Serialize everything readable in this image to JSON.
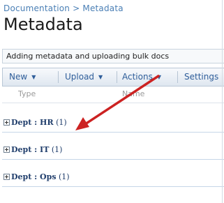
{
  "breadcrumb": "Documentation > Metadata",
  "page_title": "Metadata",
  "description": "Adding metadata and uploading bulk docs",
  "toolbar": {
    "new": "New",
    "upload": "Upload",
    "actions": "Actions",
    "settings": "Settings"
  },
  "columns": {
    "type": "Type",
    "name": "Name"
  },
  "groups": [
    {
      "field": "Dept",
      "value": "HR",
      "count": "(1)"
    },
    {
      "field": "Dept",
      "value": "IT",
      "count": "(1)"
    },
    {
      "field": "Dept",
      "value": "Ops",
      "count": "(1)"
    }
  ],
  "colors": {
    "link": "#4a7fb5",
    "toolbar_text": "#2f5e9a",
    "group_text": "#1f3d6b",
    "arrow": "#cc2222"
  }
}
